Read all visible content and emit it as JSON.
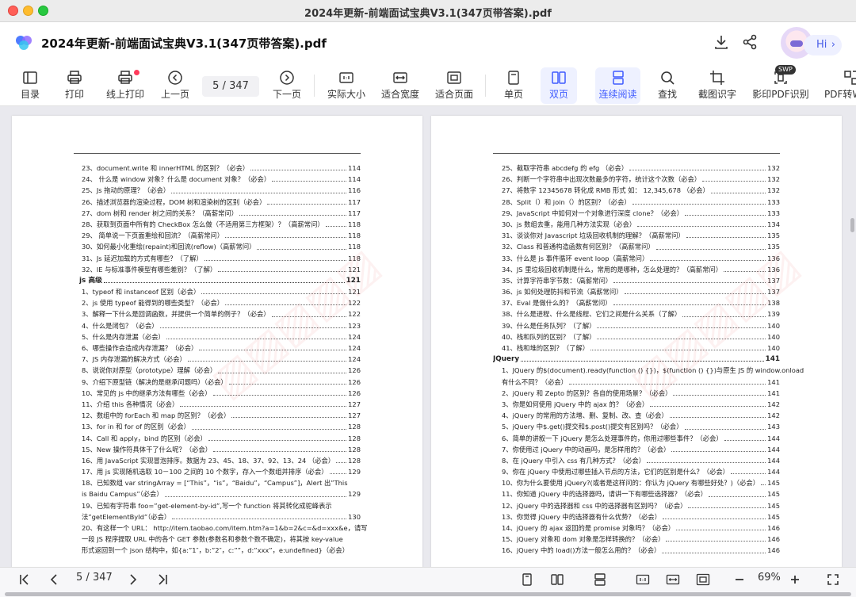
{
  "window": {
    "title": "2024年更新-前端面试宝典V3.1(347页带答案).pdf"
  },
  "header": {
    "doc_title": "2024年更新-前端面试宝典V3.1(347页带答案).pdf",
    "hi_label": "Hi",
    "hi_chevron": "›",
    "icons": [
      "download-icon",
      "share-icon",
      "assistant-avatar"
    ]
  },
  "toolbar": {
    "items": [
      {
        "label": "目录",
        "icon": "sidebar-icon"
      },
      {
        "label": "打印",
        "icon": "printer-icon"
      },
      {
        "label": "线上打印",
        "icon": "online-print-icon"
      },
      {
        "label": "上一页",
        "icon": "arrow-up-icon"
      },
      {
        "label": "下一页",
        "icon": "arrow-down-icon"
      },
      {
        "label": "实际大小",
        "icon": "actual-size-icon"
      },
      {
        "label": "适合宽度",
        "icon": "fit-width-icon"
      },
      {
        "label": "适合页面",
        "icon": "fit-page-icon"
      },
      {
        "label": "单页",
        "icon": "single-page-icon"
      },
      {
        "label": "双页",
        "icon": "double-page-icon"
      },
      {
        "label": "连续阅读",
        "icon": "continuous-icon"
      },
      {
        "label": "查找",
        "icon": "search-icon"
      },
      {
        "label": "截图识字",
        "icon": "screenshot-ocr-icon"
      },
      {
        "label": "影印PDF识别",
        "icon": "scan-pdf-icon",
        "badge": "SWP"
      },
      {
        "label": "PDF转W",
        "icon": "pdf-convert-icon"
      }
    ],
    "current_page": "5",
    "page_separator": "/",
    "total_pages": "347",
    "accent_color": "#3f5bff"
  },
  "left_page": {
    "entries": [
      {
        "text": "23、document.write 和 innerHTML 的区别？（必会）",
        "page": "114"
      },
      {
        "text": "24、 什么是 window 对象？什么是 document 对象？（必会）",
        "page": "114"
      },
      {
        "text": "25、Js 拖动的原理？（必会）",
        "page": "116"
      },
      {
        "text": "26、描述浏览器的渲染过程，DOM 树和渲染树的区别（必会）",
        "page": "117"
      },
      {
        "text": "27、dom 树和 render 树之间的关系？（高薪常问）",
        "page": "117"
      },
      {
        "text": "28、获取到页面中所有的 CheckBox 怎么做（不适用第三方框架）？（高薪常问）",
        "page": "118"
      },
      {
        "text": "29、 简单说一下页面重绘和回流？（高薪常问）",
        "page": "118"
      },
      {
        "text": "30、如何最小化重绘(repaint)和回流(reflow)（高薪常问）",
        "page": "118"
      },
      {
        "text": "31、Js 延迟加载的方式有哪些？（了解）",
        "page": "118"
      },
      {
        "text": "32、IE 与标准事件模型有哪些差别？（了解）",
        "page": "121"
      },
      {
        "text": "js 高级",
        "page": "121",
        "section": true
      },
      {
        "text": "1、typeof 和 instanceof 区别（必会）",
        "page": "121"
      },
      {
        "text": "2、js 使用 typeof 能得到的哪些类型？（必会）",
        "page": "122"
      },
      {
        "text": "3、解释一下什么是回调函数，并提供一个简单的例子？（必会）",
        "page": "122"
      },
      {
        "text": "4、什么是闭包？（必会）",
        "page": "123"
      },
      {
        "text": "5、什么是内存泄漏（必会）",
        "page": "124"
      },
      {
        "text": "6、哪些操作会造成内存泄漏？（必会）",
        "page": "124"
      },
      {
        "text": "7、JS 内存泄漏的解决方式（必会）",
        "page": "124"
      },
      {
        "text": "8、说说你对原型（prototype）理解（必会）",
        "page": "126"
      },
      {
        "text": "9、介绍下原型链（解决的是继承问题吗）（必会）",
        "page": "126"
      },
      {
        "text": "10、常见的 js 中的继承方法有哪些（必会）",
        "page": "126"
      },
      {
        "text": "11、介绍 this 各种情况（必会）",
        "page": "127"
      },
      {
        "text": "12、数组中的 forEach 和 map 的区别？（必会）",
        "page": "127"
      },
      {
        "text": "13、for in 和 for of 的区别（必会）",
        "page": "128"
      },
      {
        "text": "14、Call 和 apply，bind 的区别（必会）",
        "page": "128"
      },
      {
        "text": "15、New 操作符具体干了什么呢？（必会）",
        "page": "128"
      },
      {
        "text": "16、用 JavaScript 实现冒泡排序。数据为 23、45、18、37、92、13、24 （必会）",
        "page": "128"
      },
      {
        "text": "17、用 js 实现随机选取 10－100 之间的 10 个数字，存入一个数组并排序（必会）",
        "page": "129"
      },
      {
        "text": "18、已知数组 var stringArray = [“This”，“is”，“Baidu”，“Campus”]，Alert 出”This",
        "page": "",
        "wrap": true
      },
      {
        "text": "is Baidu Campus”（必会）",
        "page": "129"
      },
      {
        "text": "19、已知有字符串 foo=”get-element-by-id”,写一个 function 将其转化成驼峰表示",
        "page": "",
        "wrap": true
      },
      {
        "text": "法”getElementById”（必会）",
        "page": "130"
      },
      {
        "text": "20、有这样一个 URL： http://item.taobao.com/item.htm?a=1&b=2&c=&d=xxx&e，请写",
        "page": "",
        "wrap": true
      },
      {
        "text": "一段 JS 程序提取 URL 中的各个 GET 参数(参数名和参数个数不确定)，将其按 key-value",
        "page": "",
        "wrap": true
      },
      {
        "text": "形式返回到一个 json 结构中，如{a:”1″，b:”2″，c:””，d:”xxx”，e:undefined}（必会）",
        "page": "",
        "wrap": true
      }
    ]
  },
  "right_page": {
    "entries": [
      {
        "text": "25、截取字符串 abcdefg 的 efg （必会）",
        "page": "132"
      },
      {
        "text": "26、判断一个字符串中出现次数最多的字符，统计这个次数（必会）",
        "page": "132"
      },
      {
        "text": "27、将数字 12345678 转化成 RMB 形式 如： 12,345,678 （必会）",
        "page": "132"
      },
      {
        "text": "28、Split（）和 join（）的区别？（必会）",
        "page": "133"
      },
      {
        "text": "29、JavaScript 中如何对一个对象进行深度 clone？（必会）",
        "page": "133"
      },
      {
        "text": "30、js 数组去重，能用几种方法实现（必会）",
        "page": "134"
      },
      {
        "text": "31、谈谈你对 Javascript 垃圾回收机制的理解？（高薪常问）",
        "page": "135"
      },
      {
        "text": "32、Class 和普通构造函数有何区别？（高薪常问）",
        "page": "135"
      },
      {
        "text": "33、什么是 js 事件循环 event loop（高薪常问）",
        "page": "136"
      },
      {
        "text": "34、JS 里垃圾回收机制是什么，常用的是哪种，怎么处理的？（高薪常问）",
        "page": "136"
      },
      {
        "text": "35、计算字符串字节数：（高薪常问）",
        "page": "137"
      },
      {
        "text": "36、js 如何处理防抖和节流（高薪常问）",
        "page": "137"
      },
      {
        "text": "37、Eval 是做什么的？（高薪常问）",
        "page": "138"
      },
      {
        "text": "38、什么是进程、什么是线程、它们之间是什么关系（了解）",
        "page": "139"
      },
      {
        "text": "39、什么是任务队列？（了解）",
        "page": "140"
      },
      {
        "text": "40、栈和队列的区别？（了解）",
        "page": "140"
      },
      {
        "text": "41、栈和堆的区别？（了解）",
        "page": "140"
      },
      {
        "text": "JQuery",
        "page": "141",
        "section": true
      },
      {
        "text": "1、JQuery 的$(document).ready(function () {})，$(function () {})与原生 JS 的 window.onload",
        "page": "",
        "wrap": true
      },
      {
        "text": "有什么不同？（必会）",
        "page": "141"
      },
      {
        "text": "2、jQuery 和 Zepto 的区别？各自的使用场景？（必会）",
        "page": "141"
      },
      {
        "text": "3、你是如何使用 jQuery 中的 ajax 的？（必会）",
        "page": "142"
      },
      {
        "text": "4、jQuery 的常用的方法增、删、复制、改、查（必会）",
        "page": "142"
      },
      {
        "text": "5、jQuery 中$.get()提交和$.post()提交有区别吗？（必会）",
        "page": "143"
      },
      {
        "text": "6、简单的讲叙一下 jQuery 是怎么处理事件的，你用过哪些事件？（必会）",
        "page": "144"
      },
      {
        "text": "7、你使用过 jQuery 中的动画吗，是怎样用的？（必会）",
        "page": "144"
      },
      {
        "text": "8、在 jQuery 中引入 css 有几种方式？（必会）",
        "page": "144"
      },
      {
        "text": "9、你在 jQuery 中使用过哪些插入节点的方法，它们的区别是什么？（必会）",
        "page": "144"
      },
      {
        "text": "10、你为什么要使用 jQuery?(或者是这样问的：你认为 jQuery 有哪些好处？)（必会）",
        "page": "145"
      },
      {
        "text": "11、你知道 jQuery 中的选择器吗，请讲一下有哪些选择器？（必会）",
        "page": "145"
      },
      {
        "text": "12、jQuery 中的选择器和 css 中的选择器有区别吗？（必会）",
        "page": "145"
      },
      {
        "text": "13、你觉得 jQuery 中的选择器有什么优势？（必会）",
        "page": "145"
      },
      {
        "text": "14、jQuery 的 ajax 返回的是 promise 对象吗？（必会）",
        "page": "146"
      },
      {
        "text": "15、jQuery 对象和 dom 对象是怎样转换的？（必会）",
        "page": "146"
      },
      {
        "text": "16、jQuery 中的 load()方法一般怎么用的？（必会）",
        "page": "146"
      }
    ]
  },
  "bottombar": {
    "current_page": "5",
    "page_separator": "/",
    "total_pages": "347",
    "zoom": "69%",
    "icons": [
      "first-page-icon",
      "prev-page-icon",
      "next-page-icon",
      "last-page-icon",
      "single-page-icon",
      "double-page-icon",
      "continuous-icon",
      "actual-size-icon",
      "fit-width-icon",
      "fit-page-icon",
      "zoom-out-icon",
      "zoom-in-icon",
      "fullscreen-icon"
    ]
  }
}
